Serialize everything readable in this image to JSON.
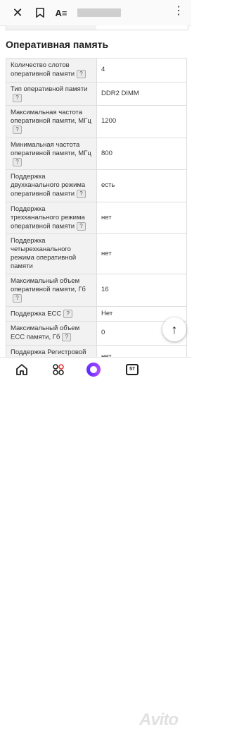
{
  "topbar": {
    "close_icon": "close-icon",
    "bookmark_icon": "bookmark-icon",
    "reader_label": "A≡",
    "menu_icon": "more-vertical-icon"
  },
  "section_title": "Оперативная память",
  "rows": [
    {
      "key": "Количество слотов оперативной памяти",
      "value": "4",
      "help": "?"
    },
    {
      "key": "Тип оперативной памяти",
      "value": "DDR2 DIMM",
      "help": "?"
    },
    {
      "key": "Максимальная частота оперативной памяти, МГц",
      "value": "1200",
      "help": "?"
    },
    {
      "key": "Минимальная частота оперативной памяти, МГц",
      "value": "800",
      "help": "?"
    },
    {
      "key": "Поддержка двухканального режима оперативной памяти",
      "value": "есть",
      "help": "?"
    },
    {
      "key": "Поддержка трехканального режима оперативной памяти",
      "value": "нет",
      "help": "?"
    },
    {
      "key": "Поддержка четырехканального режима оперативной памяти",
      "value": "нет",
      "help": ""
    },
    {
      "key": "Максимальный объем оперативной памяти, Гб",
      "value": "16",
      "help": "?"
    },
    {
      "key": "Поддержка ECC",
      "value": "Нет",
      "help": "?"
    },
    {
      "key": "Максимальный объем ECC памяти, Гб",
      "value": "0",
      "help": "?"
    },
    {
      "key": "Поддержка Регистровой (Буферизованной)",
      "value": "нет",
      "help": ""
    }
  ],
  "scroll_top_label": "↑",
  "bottomnav": {
    "tabs_count": "57",
    "watermark": "Avito"
  }
}
